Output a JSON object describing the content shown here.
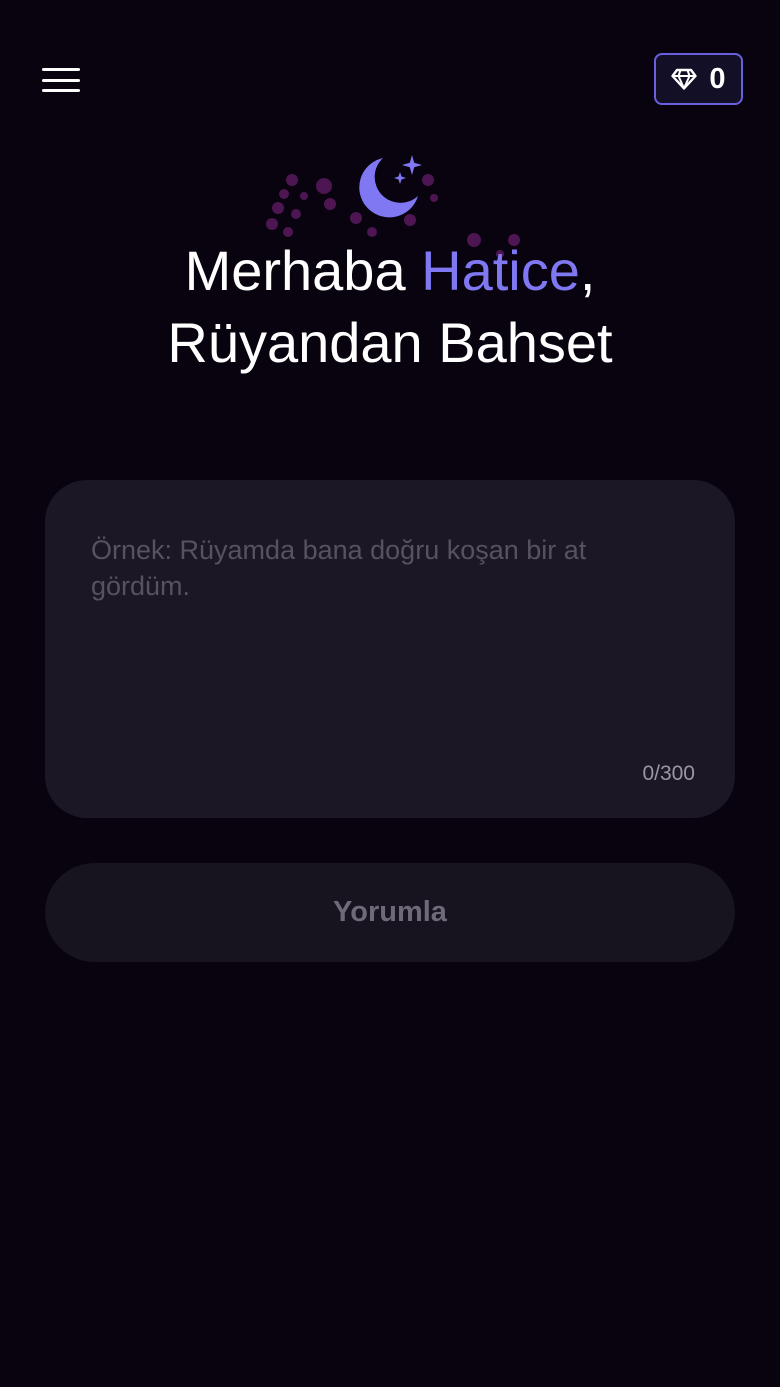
{
  "header": {
    "menu_icon": "hamburger-menu-icon",
    "gem_icon": "diamond-icon",
    "gem_count": "0",
    "accent_color": "#6a5fdc"
  },
  "hero": {
    "icon": "moon-stars-icon",
    "greeting_prefix": "Merhaba ",
    "user_name": "Hatice",
    "greeting_suffix": ",",
    "subtitle": "Rüyandan Bahset",
    "name_color": "#8078f2"
  },
  "dream_form": {
    "input_value": "",
    "placeholder": "Örnek: Rüyamda bana doğru koşan bir at gördüm.",
    "char_counter": "0/300",
    "submit_label": "Yorumla"
  }
}
